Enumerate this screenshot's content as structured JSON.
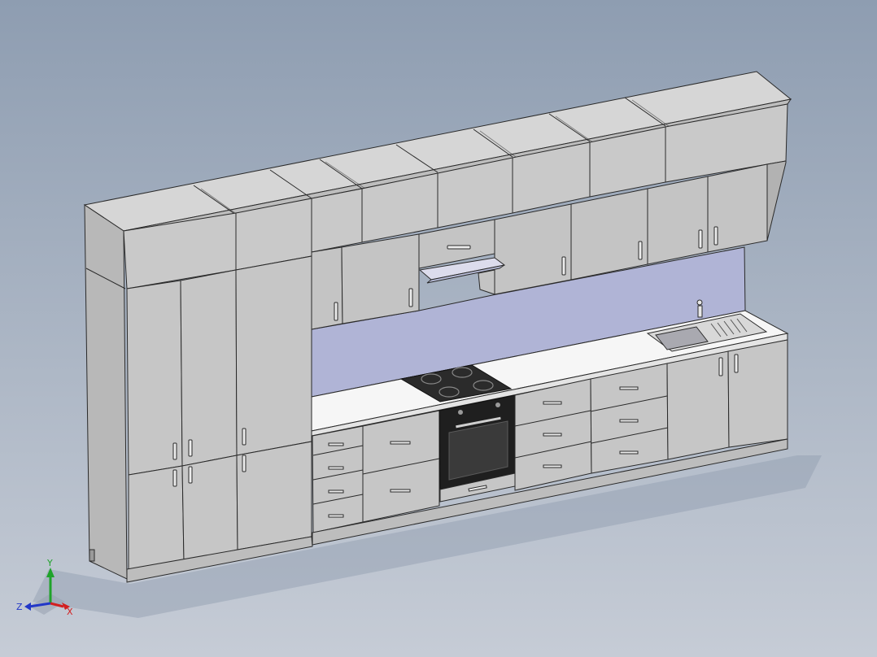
{
  "viewport": {
    "background_top": "#8e9db1",
    "background_bottom": "#c6ccd6",
    "model_color": "#c9c9c9",
    "outline_color": "#2a2a2a",
    "backsplash_color": "#b0b4d6",
    "countertop_color": "#f6f6f6"
  },
  "triad": {
    "x_label": "X",
    "y_label": "Y",
    "z_label": "Z",
    "x_color": "#d22020",
    "y_color": "#1fa32a",
    "z_color": "#2237c8"
  }
}
